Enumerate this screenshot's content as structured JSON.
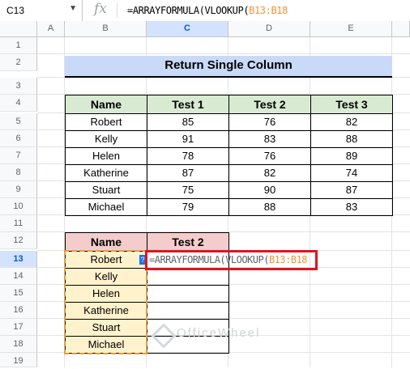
{
  "formula_bar": {
    "cell_ref": "C13",
    "fx_symbol": "fx",
    "formula_prefix": "=ARRAYFORMULA(VLOOKUP(",
    "formula_range": "B13:B18"
  },
  "columns": [
    "A",
    "B",
    "C",
    "D",
    "E"
  ],
  "rows": [
    "1",
    "2",
    "3",
    "4",
    "5",
    "6",
    "7",
    "8",
    "9",
    "10",
    "11",
    "12",
    "13",
    "14",
    "15",
    "16",
    "17",
    "18",
    "19"
  ],
  "sheet": {
    "title": "Return Single Column",
    "table1_headers": [
      "Name",
      "Test 1",
      "Test 2",
      "Test 3"
    ],
    "table1_rows": [
      [
        "Robert",
        "85",
        "76",
        "82"
      ],
      [
        "Kelly",
        "91",
        "83",
        "88"
      ],
      [
        "Helen",
        "78",
        "76",
        "89"
      ],
      [
        "Katherine",
        "87",
        "82",
        "74"
      ],
      [
        "Stuart",
        "75",
        "90",
        "87"
      ],
      [
        "Michael",
        "79",
        "88",
        "83"
      ]
    ],
    "table2_headers": [
      "Name",
      "Test 2"
    ],
    "table2_names": [
      "Robert",
      "Kelly",
      "Helen",
      "Katherine",
      "Stuart",
      "Michael"
    ],
    "editing": {
      "prefix": "=ARRAYFORMULA(VLOOKUP(",
      "range": "B13:B18",
      "hint_icon": "?"
    }
  },
  "watermark": "OfficeWheel",
  "colors": {
    "title_bg": "#c9daf8",
    "header_green": "#d9ead3",
    "header_red": "#f4cccc",
    "name_cell": "#fff2cc",
    "range_ref": "#f6913a",
    "highlight_box": "#e0141e"
  }
}
